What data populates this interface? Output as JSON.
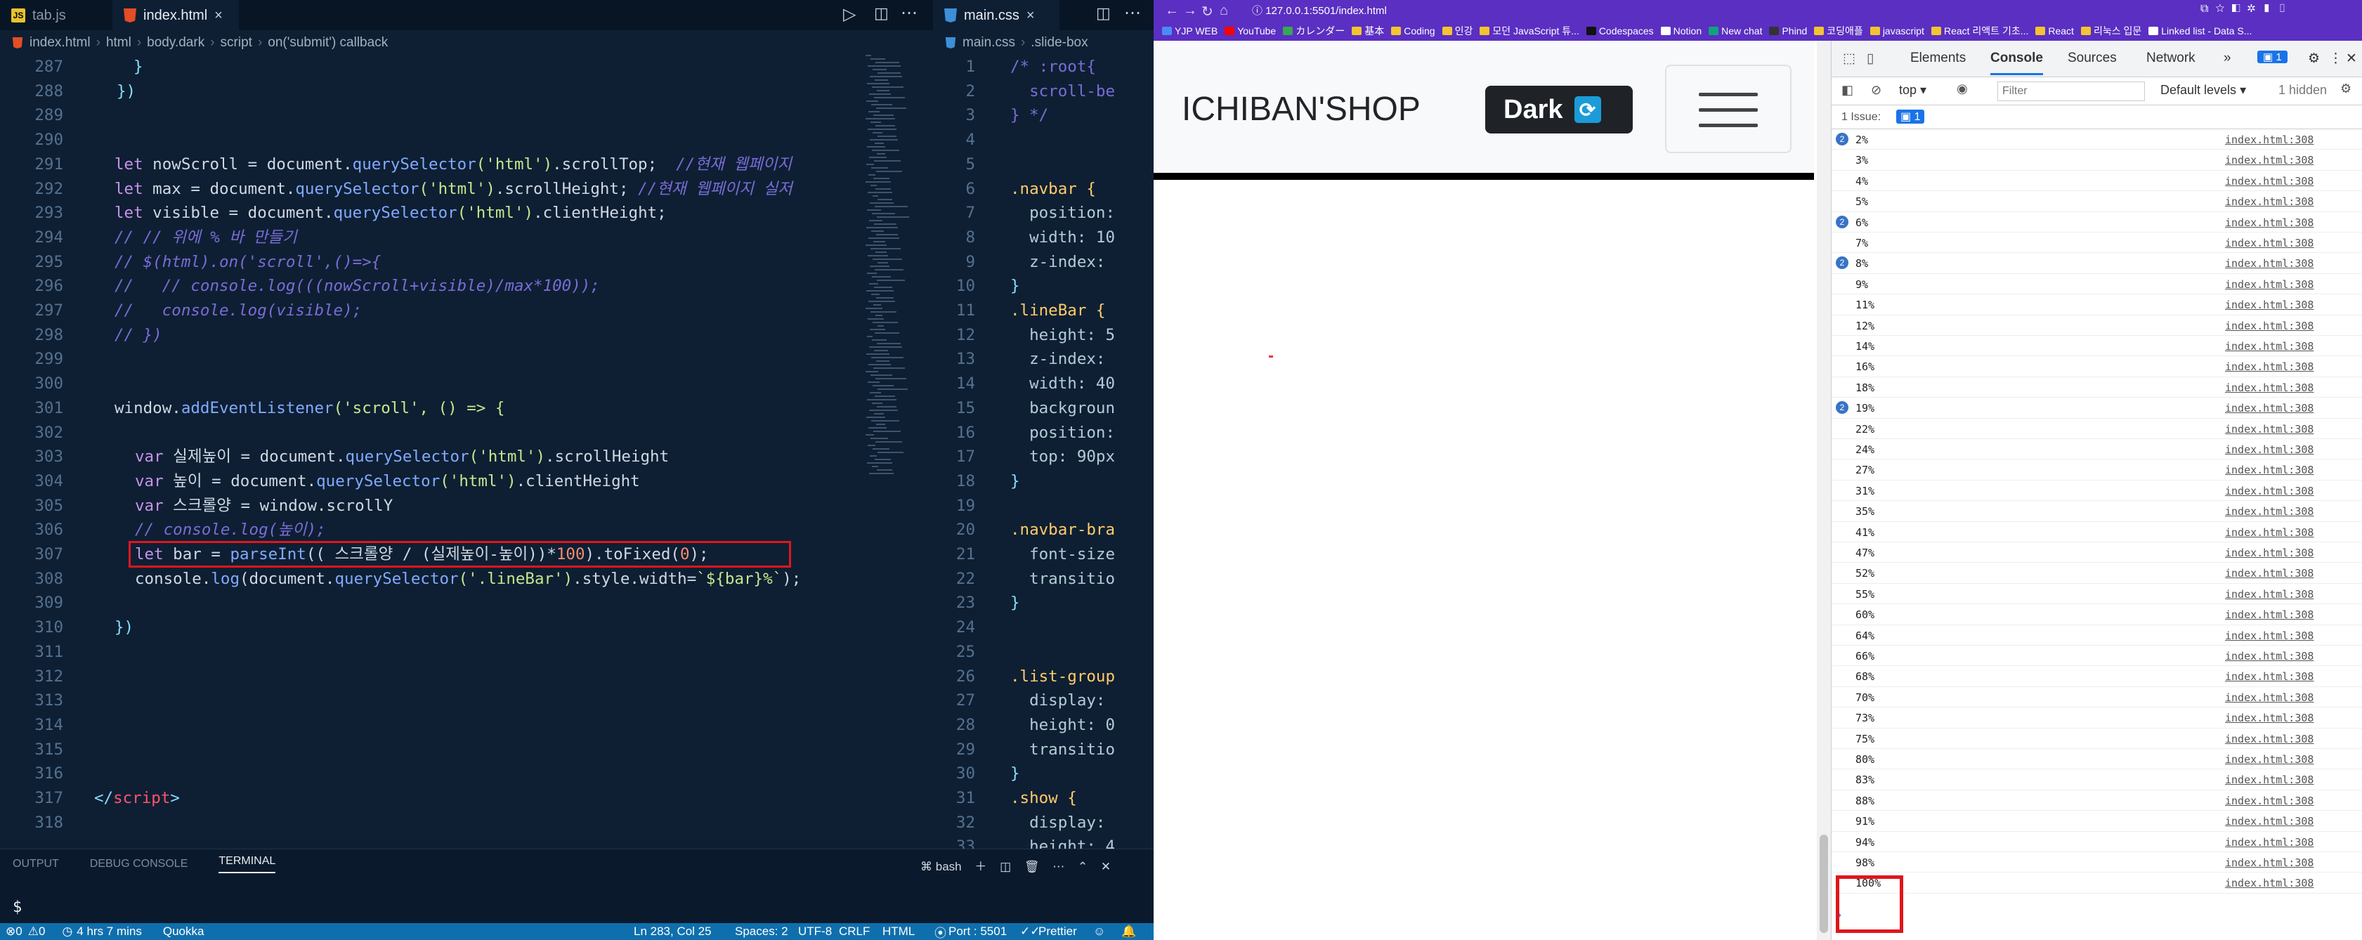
{
  "editor": {
    "tabs": [
      {
        "label": "tab.js"
      },
      {
        "label": "index.html"
      },
      {
        "label": "main.css"
      }
    ],
    "breadcrumb": [
      "index.html",
      "html",
      "body.dark",
      "script",
      "on('submit') callback"
    ],
    "breadcrumb2": [
      "main.css",
      ".slide-box"
    ],
    "line_numbers": [
      "287",
      "288",
      "289",
      "290",
      "291",
      "292",
      "293",
      "294",
      "295",
      "296",
      "297",
      "298",
      "299",
      "300",
      "301",
      "302",
      "303",
      "304",
      "305",
      "306",
      "307",
      "308",
      "309",
      "310",
      "311",
      "312",
      "313",
      "314",
      "315",
      "316",
      "317",
      "318"
    ],
    "code": {
      "l287": "}",
      "l288": "})",
      "l291a": "let",
      "l291b": " nowScroll = document.",
      "l291c": "querySelector",
      "l291d": "('html')",
      "l291e": ".scrollTop;  ",
      "l291f": "//현재 웹페이지",
      "l292a": "let",
      "l292b": " max = document.",
      "l292c": "querySelector",
      "l292d": "('html')",
      "l292e": ".scrollHeight; ",
      "l292f": "//현재 웹페이지 실저",
      "l293a": "let",
      "l293b": " visible = document.",
      "l293c": "querySelector",
      "l293d": "('html')",
      "l293e": ".clientHeight;",
      "l294": "// // 위에 % 바 만들기",
      "l295": "// $(html).on('scroll',()=>{",
      "l296": "//   // console.log(((nowScroll+visible)/max*100));",
      "l297": "//   console.log(visible);",
      "l298": "// })",
      "l301a": "window.",
      "l301b": "addEventListener",
      "l301c": "('scroll', () => {",
      "l303a": "var",
      "l303b": " 실제높이 = document.",
      "l303c": "querySelector",
      "l303d": "('html')",
      "l303e": ".scrollHeight",
      "l304a": "var",
      "l304b": " 높이 = document.",
      "l304c": "querySelector",
      "l304d": "('html')",
      "l304e": ".clientHeight",
      "l305a": "var",
      "l305b": " 스크롤양 = window.scrollY",
      "l306": "// console.log(높이);",
      "l307a": "let",
      "l307b": " bar = ",
      "l307c": "parseInt",
      "l307d": "(( 스크롤양 / (실제높이-높이))*",
      "l307e": "100",
      "l307f": ").toFixed(",
      "l307g": "0",
      "l307h": ");",
      "l308a": "console.",
      "l308b": "log",
      "l308c": "(document.",
      "l308d": "querySelector",
      "l308e": "('.lineBar')",
      "l308f": ".style.width=",
      "l308g": "`${bar}%`",
      "l308h": ");",
      "l310": "})",
      "l317a": "</",
      "l317b": "script",
      "l317c": ">"
    },
    "css_line_numbers": [
      "1",
      "2",
      "3",
      "4",
      "5",
      "6",
      "7",
      "8",
      "9",
      "10",
      "11",
      "12",
      "13",
      "14",
      "15",
      "16",
      "17",
      "18",
      "19",
      "20",
      "21",
      "22",
      "23",
      "24",
      "25",
      "26",
      "27",
      "28",
      "29",
      "30",
      "31",
      "32",
      "33"
    ],
    "css_code": [
      "/* :root{",
      "  scroll-be",
      "} */",
      "",
      "",
      ".navbar {",
      "  position:",
      "  width: 10",
      "  z-index:",
      "}",
      ".lineBar {",
      "  height: 5",
      "  z-index:",
      "  width: 40",
      "  backgroun",
      "  position:",
      "  top: 90px",
      "}",
      "",
      ".navbar-bra",
      "  font-size",
      "  transitio",
      "}",
      "",
      "",
      ".list-group",
      "  display:",
      "  height: 0",
      "  transitio",
      "}",
      ".show {",
      "  display:",
      "  height: 4."
    ],
    "panel": {
      "tabs": [
        "OUTPUT",
        "DEBUG CONSOLE",
        "TERMINAL"
      ],
      "shell": "bash",
      "prompt": "$"
    },
    "status": {
      "errors": "0",
      "warnings": "0",
      "time": "4 hrs 7 mins",
      "quokka": "Quokka",
      "pos": "Ln 283, Col 25",
      "spaces": "Spaces: 2",
      "enc": "UTF-8",
      "eol": "CRLF",
      "lang": "HTML",
      "port": "Port : 5501",
      "prettier": "Prettier"
    }
  },
  "browser": {
    "url": "127.0.0.1:5501/index.html",
    "bookmarks": [
      "YJP WEB",
      "YouTube",
      "カレンダー",
      "基本",
      "Coding",
      "인강",
      "모던 JavaScript 튜...",
      "Codespaces",
      "Notion",
      "New chat",
      "Phind",
      "코딩애플",
      "javascript",
      "React 리액트 기초...",
      "React",
      "리눅스 입문",
      "Linked list - Data S..."
    ],
    "bookmark_colors": [
      "#4c8bf5",
      "#ff0000",
      "#34a853",
      "#f4c430",
      "#f4c430",
      "#f4c430",
      "#f4c430",
      "#111111",
      "#ffffff",
      "#10a37f",
      "#333333",
      "#f4c430",
      "#f4c430",
      "#f4c430",
      "#f4c430",
      "#f4c430",
      "#ffffff"
    ],
    "brand": "ICHIBAN'SHOP",
    "dark_label": "Dark",
    "devtools": {
      "tabs": [
        "Elements",
        "Console",
        "Sources",
        "Network"
      ],
      "badge": "1",
      "context": "top",
      "filter_placeholder": "Filter",
      "levels": "Default levels",
      "hidden": "1 hidden",
      "issues_label": "1 Issue:",
      "issues_count": "1",
      "logs": [
        {
          "msg": "2%",
          "count": "2"
        },
        {
          "msg": "3%",
          "count": ""
        },
        {
          "msg": "4%",
          "count": ""
        },
        {
          "msg": "5%",
          "count": ""
        },
        {
          "msg": "6%",
          "count": "2"
        },
        {
          "msg": "7%",
          "count": ""
        },
        {
          "msg": "8%",
          "count": "2"
        },
        {
          "msg": "9%",
          "count": ""
        },
        {
          "msg": "11%",
          "count": ""
        },
        {
          "msg": "12%",
          "count": ""
        },
        {
          "msg": "14%",
          "count": ""
        },
        {
          "msg": "16%",
          "count": ""
        },
        {
          "msg": "18%",
          "count": ""
        },
        {
          "msg": "19%",
          "count": "2"
        },
        {
          "msg": "22%",
          "count": ""
        },
        {
          "msg": "24%",
          "count": ""
        },
        {
          "msg": "27%",
          "count": ""
        },
        {
          "msg": "31%",
          "count": ""
        },
        {
          "msg": "35%",
          "count": ""
        },
        {
          "msg": "41%",
          "count": ""
        },
        {
          "msg": "47%",
          "count": ""
        },
        {
          "msg": "52%",
          "count": ""
        },
        {
          "msg": "55%",
          "count": ""
        },
        {
          "msg": "60%",
          "count": ""
        },
        {
          "msg": "64%",
          "count": ""
        },
        {
          "msg": "66%",
          "count": ""
        },
        {
          "msg": "68%",
          "count": ""
        },
        {
          "msg": "70%",
          "count": ""
        },
        {
          "msg": "73%",
          "count": ""
        },
        {
          "msg": "75%",
          "count": ""
        },
        {
          "msg": "80%",
          "count": ""
        },
        {
          "msg": "83%",
          "count": ""
        },
        {
          "msg": "88%",
          "count": ""
        },
        {
          "msg": "91%",
          "count": ""
        },
        {
          "msg": "94%",
          "count": ""
        },
        {
          "msg": "98%",
          "count": ""
        },
        {
          "msg": "100%",
          "count": ""
        }
      ],
      "source": "index.html:308"
    }
  }
}
